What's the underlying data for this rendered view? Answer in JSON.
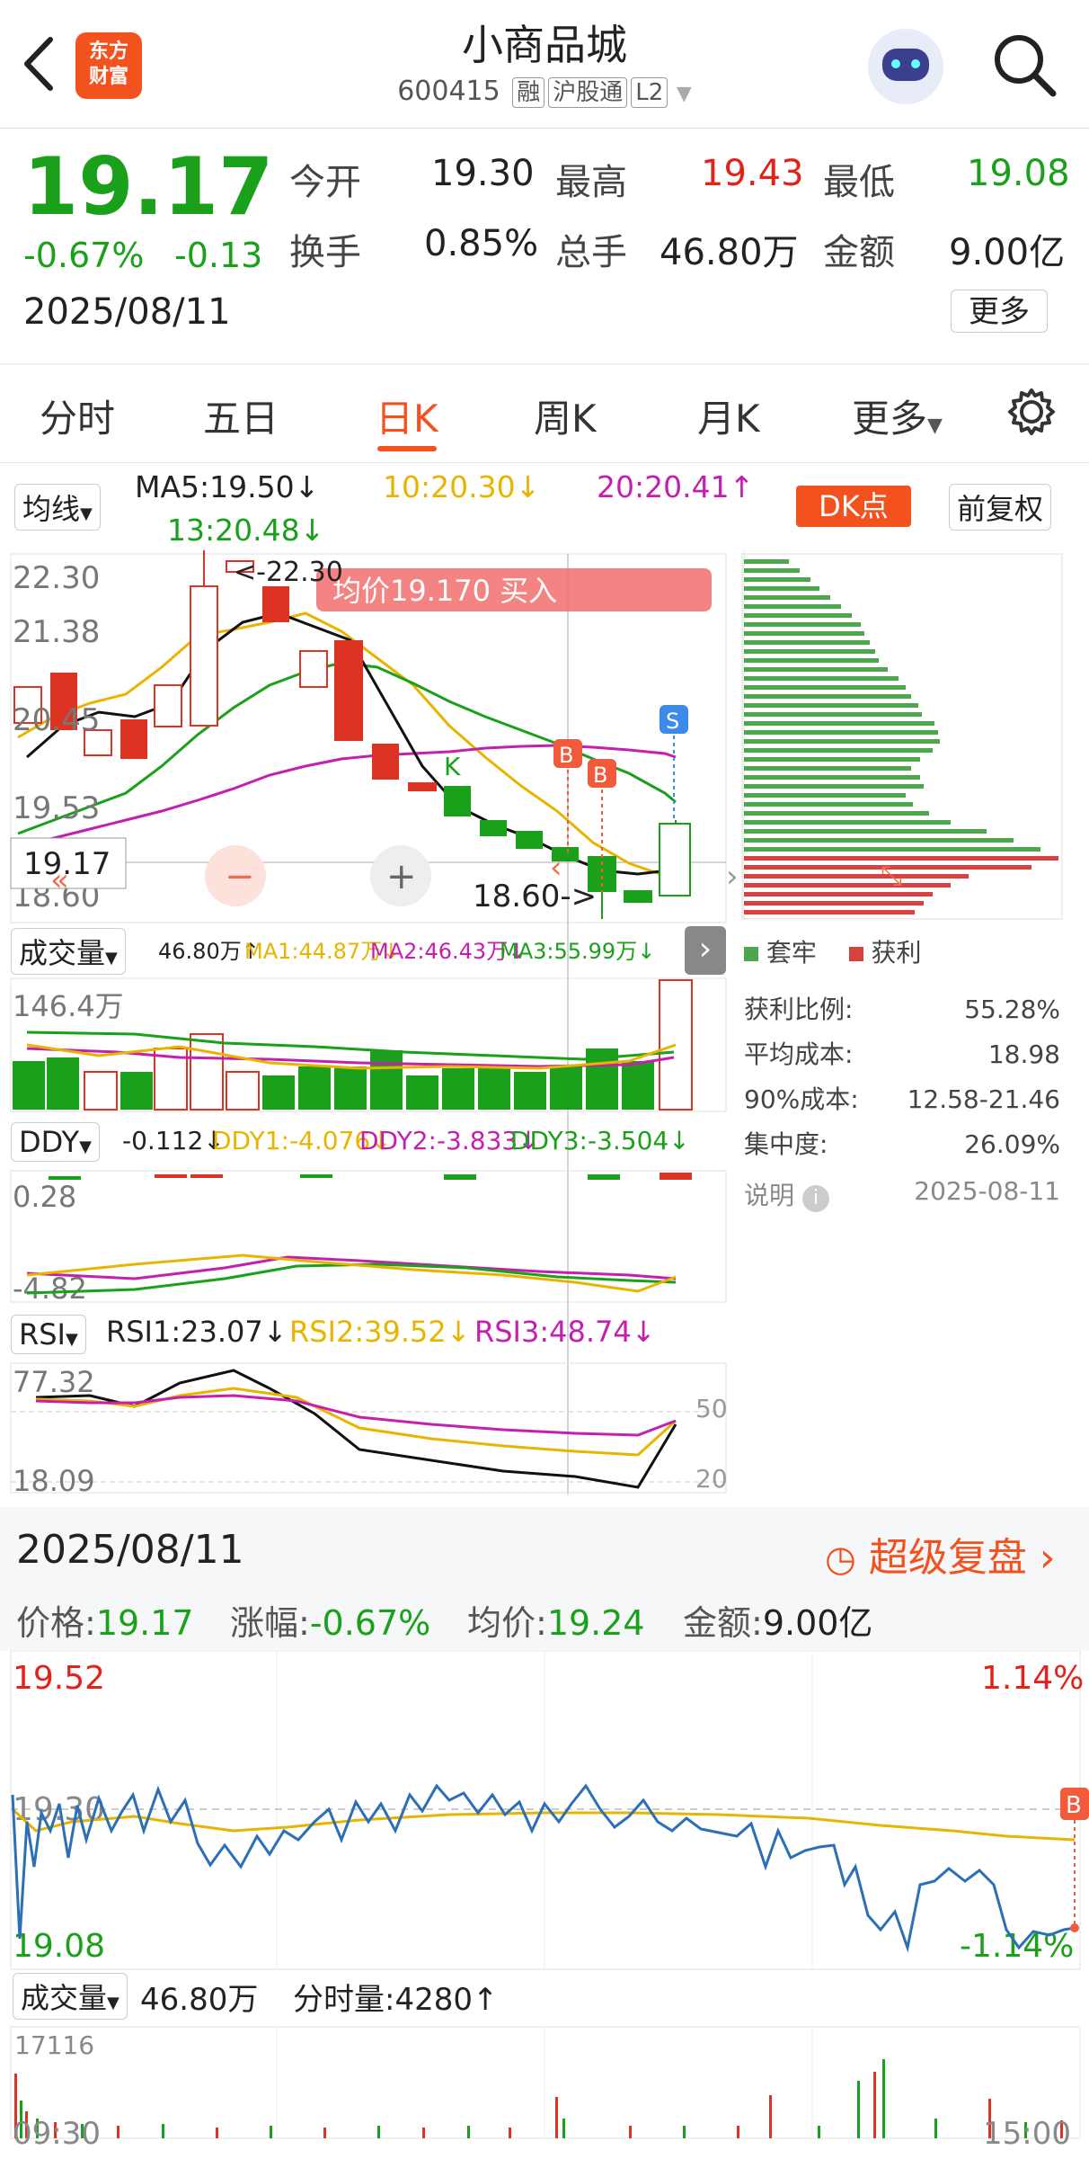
{
  "header": {
    "back_icon": "chevron-left-icon",
    "logo_line1": "东方",
    "logo_line2": "财富",
    "title": "小商品城",
    "code": "600415",
    "chips": [
      "融",
      "沪股通",
      "L2"
    ],
    "colors": {
      "logo": "#f3521f",
      "up": "#e2231a",
      "down": "#1aa01a"
    }
  },
  "quote": {
    "price": "19.17",
    "change_pct": "-0.67%",
    "change": "-0.13",
    "date": "2025/08/11",
    "open_label": "今开",
    "open": "19.30",
    "high_label": "最高",
    "high": "19.43",
    "low_label": "最低",
    "low": "19.08",
    "turnover_label": "换手",
    "turnover": "0.85%",
    "volume_label": "总手",
    "volume": "46.80万",
    "amount_label": "金额",
    "amount": "9.00亿",
    "more_button": "更多"
  },
  "tabs": [
    {
      "label": "分时"
    },
    {
      "label": "五日"
    },
    {
      "label": "日K",
      "active": true
    },
    {
      "label": "周K"
    },
    {
      "label": "月K"
    },
    {
      "label": "更多"
    }
  ],
  "ma_bar": {
    "selector": "均线",
    "ma5": "MA5:19.50",
    "ma10": "10:20.30",
    "ma20": "20:20.41",
    "ma13": "13:20.48",
    "dk_button": "DK点",
    "adjust_button": "前复权"
  },
  "kline": {
    "y_labels": [
      "22.30",
      "21.38",
      "20.45",
      "19.53",
      "18.60"
    ],
    "high_label": "<-22.30",
    "low_label": "18.60->",
    "cursor_price": "19.17",
    "banner": "均价19.170  买入",
    "markers": [
      "K",
      "B",
      "B",
      "S"
    ],
    "minus_btn": "−",
    "plus_btn": "+"
  },
  "chip_panel": {
    "legend_trapped": "套牢",
    "legend_profit": "获利",
    "rows": [
      {
        "label": "获利比例:",
        "value": "55.28%"
      },
      {
        "label": "平均成本:",
        "value": "18.98"
      },
      {
        "label": "90%成本:",
        "value": "12.58-21.46"
      },
      {
        "label": "集中度:",
        "value": "26.09%"
      }
    ],
    "note_label": "说明",
    "note_date": "2025-08-11"
  },
  "volume_panel": {
    "selector": "成交量",
    "total": "46.80万",
    "ma1": "MA1:44.87万",
    "ma2": "MA2:46.43万",
    "ma3": "MA3:55.99万",
    "y_label": "146.4万"
  },
  "ddy_panel": {
    "selector": "DDY",
    "value": "-0.112",
    "ddy1": "DDY1:-4.076",
    "ddy2": "DDY2:-3.833",
    "ddy3": "DDY3:-3.504",
    "y_top": "0.28",
    "y_bottom": "-4.82"
  },
  "rsi_panel": {
    "selector": "RSI",
    "rsi1": "RSI1:23.07",
    "rsi2": "RSI2:39.52",
    "rsi3": "RSI3:48.74",
    "y_top": "77.32",
    "y_bottom": "18.09",
    "right_50": "50",
    "right_20": "20"
  },
  "replay": {
    "date": "2025/08/11",
    "button": "超级复盘",
    "price_label": "价格:",
    "price": "19.17",
    "chg_label": "涨幅:",
    "chg": "-0.67%",
    "avg_label": "均价:",
    "avg": "19.24",
    "amt_label": "金额:",
    "amt": "9.00亿"
  },
  "intraday": {
    "y_top": "19.52",
    "y_mid": "19.30",
    "y_bottom": "19.08",
    "pct_top": "1.14%",
    "pct_bottom": "-1.14%",
    "marker": "B",
    "vol_selector": "成交量",
    "vol_total": "46.80万",
    "vol_minute": "分时量:4280",
    "vol_y": "17116",
    "time_start": "09:30",
    "time_end": "15:00"
  }
}
